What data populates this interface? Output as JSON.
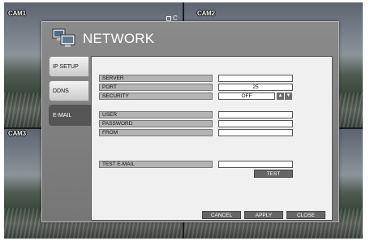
{
  "cameras": {
    "cam1": "CAM1",
    "cam2": "CAM2",
    "cam3": "CAM3",
    "rec_indicator": "C"
  },
  "dialog": {
    "title": "NETWORK",
    "icon": "network-computers-icon"
  },
  "tabs": [
    {
      "label": "IP SETUP",
      "active": false
    },
    {
      "label": "DDNS",
      "active": false
    },
    {
      "label": "E-MAIL",
      "active": true
    }
  ],
  "email": {
    "server": {
      "label": "SERVER",
      "value": ""
    },
    "port": {
      "label": "PORT",
      "value": "25"
    },
    "security": {
      "label": "SECURITY",
      "value": "OFF",
      "up_icon": "arrow-up-icon",
      "down_icon": "arrow-down-icon"
    },
    "user": {
      "label": "USER",
      "value": ""
    },
    "password": {
      "label": "PASSWORD",
      "value": ""
    },
    "from": {
      "label": "FROM",
      "value": ""
    },
    "test_email": {
      "label": "TEST E-MAIL",
      "value": ""
    },
    "test_button": "TEST"
  },
  "footer": {
    "cancel": "CANCEL",
    "apply": "APPLY",
    "close": "CLOSE"
  },
  "colors": {
    "dialog_bg": "#7f7f7f",
    "active_tab": "#555555",
    "button": "#666666"
  }
}
